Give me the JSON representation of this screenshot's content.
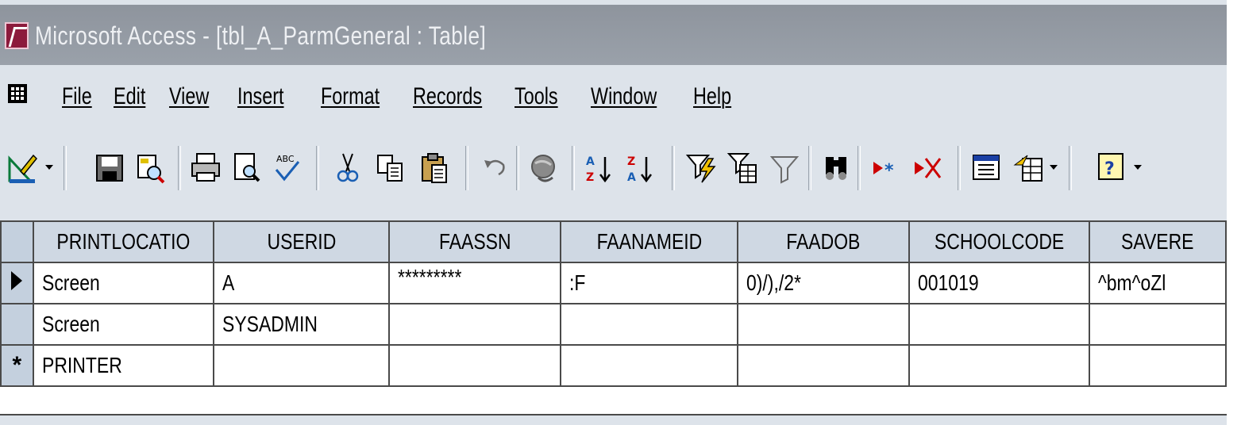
{
  "window": {
    "title": "Microsoft Access - [tbl_A_ParmGeneral : Table]"
  },
  "menu": {
    "items": [
      "File",
      "Edit",
      "View",
      "Insert",
      "Format",
      "Records",
      "Tools",
      "Window",
      "Help"
    ]
  },
  "toolbar": {
    "icons": [
      "view-design-icon",
      "save-icon",
      "search-file-icon",
      "print-icon",
      "print-preview-icon",
      "spelling-icon",
      "cut-icon",
      "copy-icon",
      "paste-icon",
      "undo-icon",
      "insert-hyperlink-icon",
      "sort-ascending-icon",
      "sort-descending-icon",
      "filter-by-selection-icon",
      "filter-by-form-icon",
      "apply-filter-icon",
      "find-icon",
      "new-record-icon",
      "delete-record-icon",
      "database-window-icon",
      "new-object-icon",
      "help-icon"
    ]
  },
  "table": {
    "columns": [
      "PRINTLOCATIO",
      "USERID",
      "FAASSN",
      "FAANAMEID",
      "FAADOB",
      "SCHOOLCODE",
      "SAVERE"
    ],
    "rows": [
      [
        "Screen",
        "A",
        "*********",
        ":F",
        "0)/),/2*",
        "001019",
        "^bm^oZl"
      ],
      [
        "Screen",
        "SYSADMIN",
        "",
        "",
        "",
        "",
        ""
      ],
      [
        "PRINTER",
        "",
        "",
        "",
        "",
        "",
        ""
      ]
    ],
    "row_selectors": [
      "current",
      "",
      "new"
    ],
    "new_row_marker": "*"
  },
  "colors": {
    "title_bar": "#9aa1aa",
    "menu_bg": "#dde3ea",
    "header_bg": "#cfd8e3",
    "top_border": "#2e2f86"
  }
}
